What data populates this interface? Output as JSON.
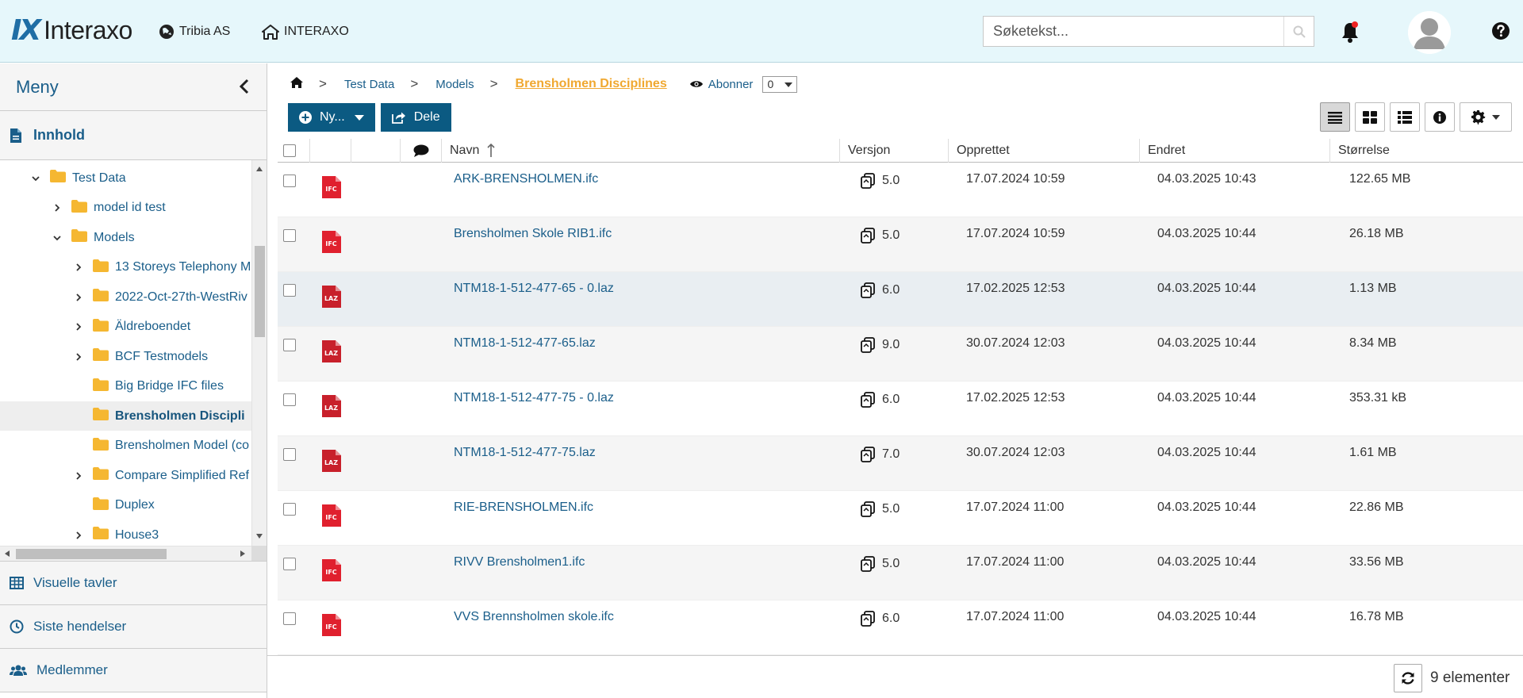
{
  "header": {
    "brand": "Interaxo",
    "brand_mark": "IX",
    "org": "Tribia AS",
    "home": "INTERAXO",
    "search_placeholder": "Søketekst..."
  },
  "sidebar": {
    "menu_title": "Meny",
    "content_label": "Innhold",
    "tree": [
      {
        "label": "Test Data",
        "level": 0,
        "expander": "open"
      },
      {
        "label": "model id test",
        "level": 1,
        "expander": "closed"
      },
      {
        "label": "Models",
        "level": 1,
        "expander": "open"
      },
      {
        "label": "13 Storeys Telephony M",
        "level": 2,
        "expander": "closed"
      },
      {
        "label": "2022-Oct-27th-WestRiv",
        "level": 2,
        "expander": "closed"
      },
      {
        "label": "Äldreboendet",
        "level": 2,
        "expander": "closed"
      },
      {
        "label": "BCF Testmodels",
        "level": 2,
        "expander": "closed"
      },
      {
        "label": "Big Bridge IFC files",
        "level": 2,
        "expander": "none"
      },
      {
        "label": "Brensholmen Discipli",
        "level": 2,
        "expander": "none",
        "selected": true
      },
      {
        "label": "Brensholmen Model (co",
        "level": 2,
        "expander": "none"
      },
      {
        "label": "Compare Simplified Ref",
        "level": 2,
        "expander": "closed"
      },
      {
        "label": "Duplex",
        "level": 2,
        "expander": "none"
      },
      {
        "label": "House3",
        "level": 2,
        "expander": "closed"
      }
    ],
    "links": [
      "Visuelle tavler",
      "Siste hendelser",
      "Medlemmer"
    ]
  },
  "breadcrumb": {
    "items": [
      "Test Data",
      "Models"
    ],
    "current": "Brensholmen Disciplines",
    "separator": ">",
    "subscribe": "Abonner",
    "subscribe_count": "0"
  },
  "toolbar": {
    "new_label": "Ny...",
    "share_label": "Dele"
  },
  "table": {
    "columns": [
      "Navn",
      "Versjon",
      "Opprettet",
      "Endret",
      "Størrelse"
    ],
    "rows": [
      {
        "type": "IFC",
        "name": "ARK-BRENSHOLMEN.ifc",
        "version": "5.0",
        "created": "17.07.2024 10:59",
        "modified": "04.03.2025 10:43",
        "size": "122.65 MB"
      },
      {
        "type": "IFC",
        "name": "Brensholmen Skole RIB1.ifc",
        "version": "5.0",
        "created": "17.07.2024 10:59",
        "modified": "04.03.2025 10:44",
        "size": "26.18 MB"
      },
      {
        "type": "LAZ",
        "name": "NTM18-1-512-477-65 - 0.laz",
        "version": "6.0",
        "created": "17.02.2025 12:53",
        "modified": "04.03.2025 10:44",
        "size": "1.13 MB"
      },
      {
        "type": "LAZ",
        "name": "NTM18-1-512-477-65.laz",
        "version": "9.0",
        "created": "30.07.2024 12:03",
        "modified": "04.03.2025 10:44",
        "size": "8.34 MB"
      },
      {
        "type": "LAZ",
        "name": "NTM18-1-512-477-75 - 0.laz",
        "version": "6.0",
        "created": "17.02.2025 12:53",
        "modified": "04.03.2025 10:44",
        "size": "353.31 kB"
      },
      {
        "type": "LAZ",
        "name": "NTM18-1-512-477-75.laz",
        "version": "7.0",
        "created": "30.07.2024 12:03",
        "modified": "04.03.2025 10:44",
        "size": "1.61 MB"
      },
      {
        "type": "IFC",
        "name": "RIE-BRENSHOLMEN.ifc",
        "version": "5.0",
        "created": "17.07.2024 11:00",
        "modified": "04.03.2025 10:44",
        "size": "22.86 MB"
      },
      {
        "type": "IFC",
        "name": "RIVV Brensholmen1.ifc",
        "version": "5.0",
        "created": "17.07.2024 11:00",
        "modified": "04.03.2025 10:44",
        "size": "33.56 MB"
      },
      {
        "type": "IFC",
        "name": "VVS Brennsholmen skole.ifc",
        "version": "6.0",
        "created": "17.07.2024 11:00",
        "modified": "04.03.2025 10:44",
        "size": "16.78 MB"
      }
    ]
  },
  "footer": {
    "count_label": "9 elementer"
  },
  "colors": {
    "accent": "#0b5a82",
    "link": "#1a5e8a",
    "current_crumb": "#f0a830",
    "folder": "#f5b731",
    "ifc_badge": "#e0202e",
    "laz_badge": "#c8202b"
  }
}
